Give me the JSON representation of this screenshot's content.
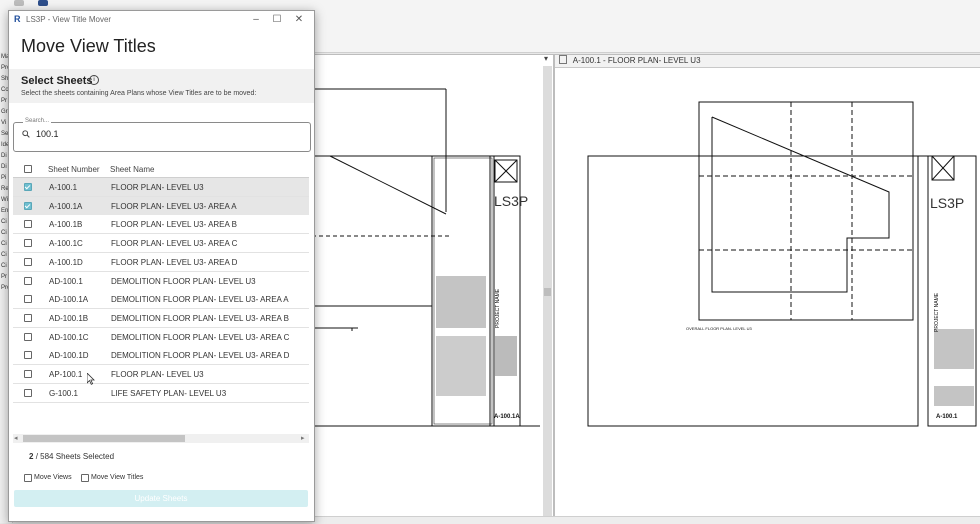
{
  "app": {
    "left_labels": [
      "Ma",
      "Pro",
      "Sh",
      "Co",
      "Pr",
      "Gri",
      "Vi",
      "Se",
      "Ide",
      "Di",
      "Di",
      "Pi",
      "Re",
      "Wi",
      "En",
      "Ci",
      "Ci",
      "Ci",
      "Ci",
      "Ci",
      "Pr",
      "Pro"
    ],
    "right_tab_title": "A-100.1 - FLOOR PLAN- LEVEL U3"
  },
  "dialog": {
    "window_title": "LS3P - View Title Mover",
    "heading": "Move View Titles",
    "section_title": "Select Sheets",
    "section_description": "Select the sheets containing Area Plans whose View Titles are to be moved:",
    "search": {
      "legend": "Search...",
      "value": "100.1"
    },
    "columns": {
      "number": "Sheet Number",
      "name": "Sheet Name"
    },
    "rows": [
      {
        "number": "A-100.1",
        "name": "FLOOR PLAN- LEVEL U3",
        "checked": true
      },
      {
        "number": "A-100.1A",
        "name": "FLOOR PLAN- LEVEL U3- AREA A",
        "checked": true
      },
      {
        "number": "A-100.1B",
        "name": "FLOOR PLAN- LEVEL U3- AREA B",
        "checked": false
      },
      {
        "number": "A-100.1C",
        "name": "FLOOR PLAN- LEVEL U3- AREA C",
        "checked": false
      },
      {
        "number": "A-100.1D",
        "name": "FLOOR PLAN- LEVEL U3- AREA D",
        "checked": false
      },
      {
        "number": "AD-100.1",
        "name": "DEMOLITION FLOOR PLAN- LEVEL U3",
        "checked": false
      },
      {
        "number": "AD-100.1A",
        "name": "DEMOLITION FLOOR PLAN- LEVEL U3- AREA A",
        "checked": false
      },
      {
        "number": "AD-100.1B",
        "name": "DEMOLITION FLOOR PLAN- LEVEL U3- AREA B",
        "checked": false
      },
      {
        "number": "AD-100.1C",
        "name": "DEMOLITION FLOOR PLAN- LEVEL U3- AREA C",
        "checked": false
      },
      {
        "number": "AD-100.1D",
        "name": "DEMOLITION FLOOR PLAN- LEVEL U3- AREA D",
        "checked": false
      },
      {
        "number": "AP-100.1",
        "name": "FLOOR PLAN- LEVEL U3",
        "checked": false
      },
      {
        "number": "G-100.1",
        "name": "LIFE SAFETY PLAN- LEVEL U3",
        "checked": false
      }
    ],
    "selected_count": "2",
    "count_separator": "/",
    "total_count": "584",
    "count_suffix": "Sheets Selected",
    "options": {
      "move_views": "Move Views",
      "move_view_titles": "Move View Titles"
    },
    "update_button": "Update Sheets"
  },
  "drawing": {
    "left_sheet_number": "A-100.1A",
    "right_sheet_number": "A-100.1",
    "project_name_label": "PROJECT NAME",
    "firm_logo": "LS3P",
    "right_view_title": "OVERALL FLOOR PLAN- LEVEL U3"
  },
  "colors": {
    "accent": "#6fbfd0",
    "button_disabled": "#d3eff2",
    "selected_row": "#e6e6e6"
  }
}
